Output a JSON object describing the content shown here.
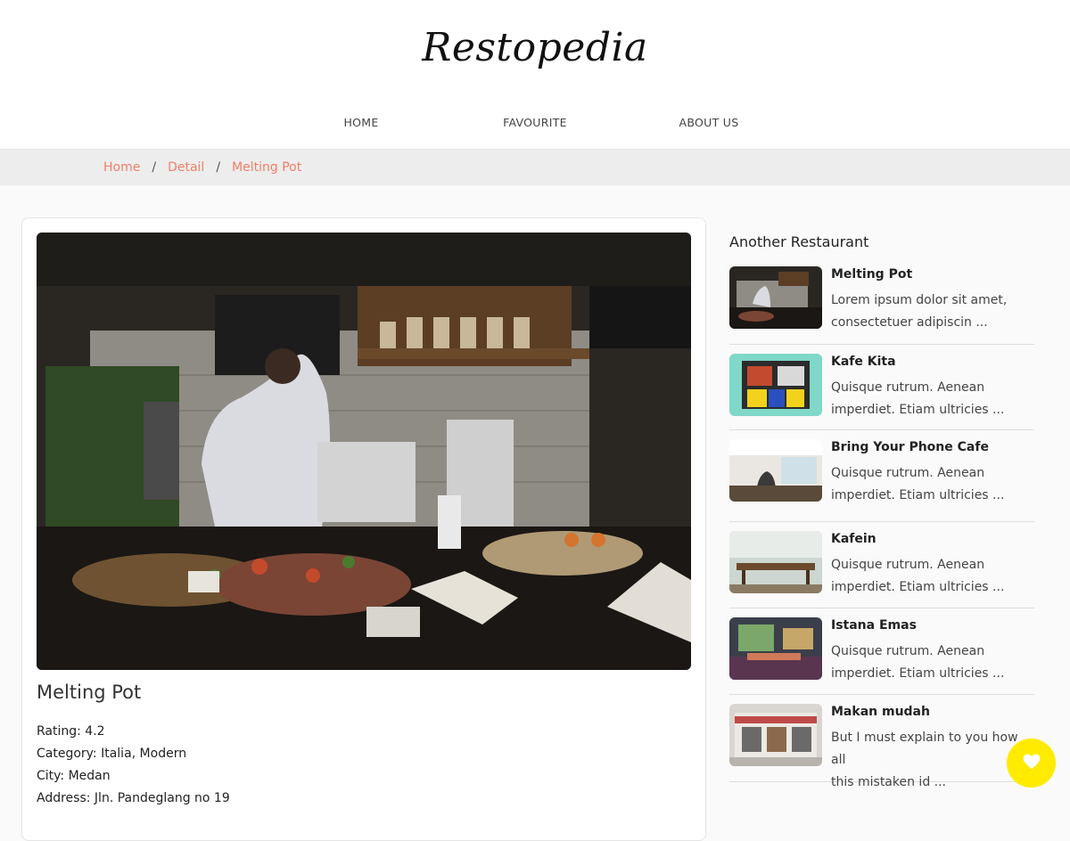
{
  "app": {
    "logo": "Restopedia"
  },
  "nav": [
    {
      "label": "HOME"
    },
    {
      "label": "FAVOURITE"
    },
    {
      "label": "ABOUT US"
    }
  ],
  "breadcrumb": {
    "items": [
      "Home",
      "Detail",
      "Melting Pot"
    ],
    "separator": "/"
  },
  "restaurant": {
    "name": "Melting Pot",
    "info": [
      "Rating: 4.2",
      "Category: Italia, Modern",
      "City: Medan",
      "Address: Jln. Pandeglang no 19"
    ]
  },
  "sidebar": {
    "title": "Another Restaurant",
    "items": [
      {
        "title": "Melting Pot",
        "desc1": "Lorem ipsum dolor sit amet,",
        "desc2": "consectetuer adipiscin ..."
      },
      {
        "title": "Kafe Kita",
        "desc1": "Quisque rutrum. Aenean",
        "desc2": "imperdiet. Etiam ultricies ..."
      },
      {
        "title": "Bring Your Phone Cafe",
        "desc1": "Quisque rutrum. Aenean",
        "desc2": "imperdiet. Etiam ultricies ..."
      },
      {
        "title": "Kafein",
        "desc1": "Quisque rutrum. Aenean",
        "desc2": "imperdiet. Etiam ultricies ..."
      },
      {
        "title": "Istana Emas",
        "desc1": "Quisque rutrum. Aenean",
        "desc2": "imperdiet. Etiam ultricies ..."
      },
      {
        "title": "Makan mudah",
        "desc1": "But I must explain to you how all",
        "desc2": "this mistaken id ..."
      }
    ]
  },
  "favorite_button": {
    "icon": "heart-icon",
    "color": "#ffeb00"
  },
  "colors": {
    "accent": "#f07f68",
    "fab": "#ffeb00"
  }
}
